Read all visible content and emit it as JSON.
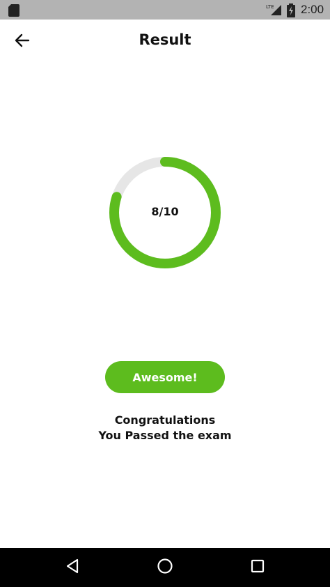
{
  "status_bar": {
    "time": "2:00",
    "network_label": "LTE"
  },
  "header": {
    "title": "Result",
    "back_icon": "arrow-left-icon"
  },
  "score": {
    "label": "8/10",
    "correct": 8,
    "total": 10,
    "ring_color": "#5dbc1e",
    "track_color": "#e6e6e6"
  },
  "result": {
    "button_label": "Awesome!",
    "message_line1": "Congratulations",
    "message_line2": "You Passed the exam"
  },
  "nav_bar": {
    "back_icon": "triangle-back-icon",
    "home_icon": "circle-home-icon",
    "recents_icon": "square-recents-icon"
  }
}
